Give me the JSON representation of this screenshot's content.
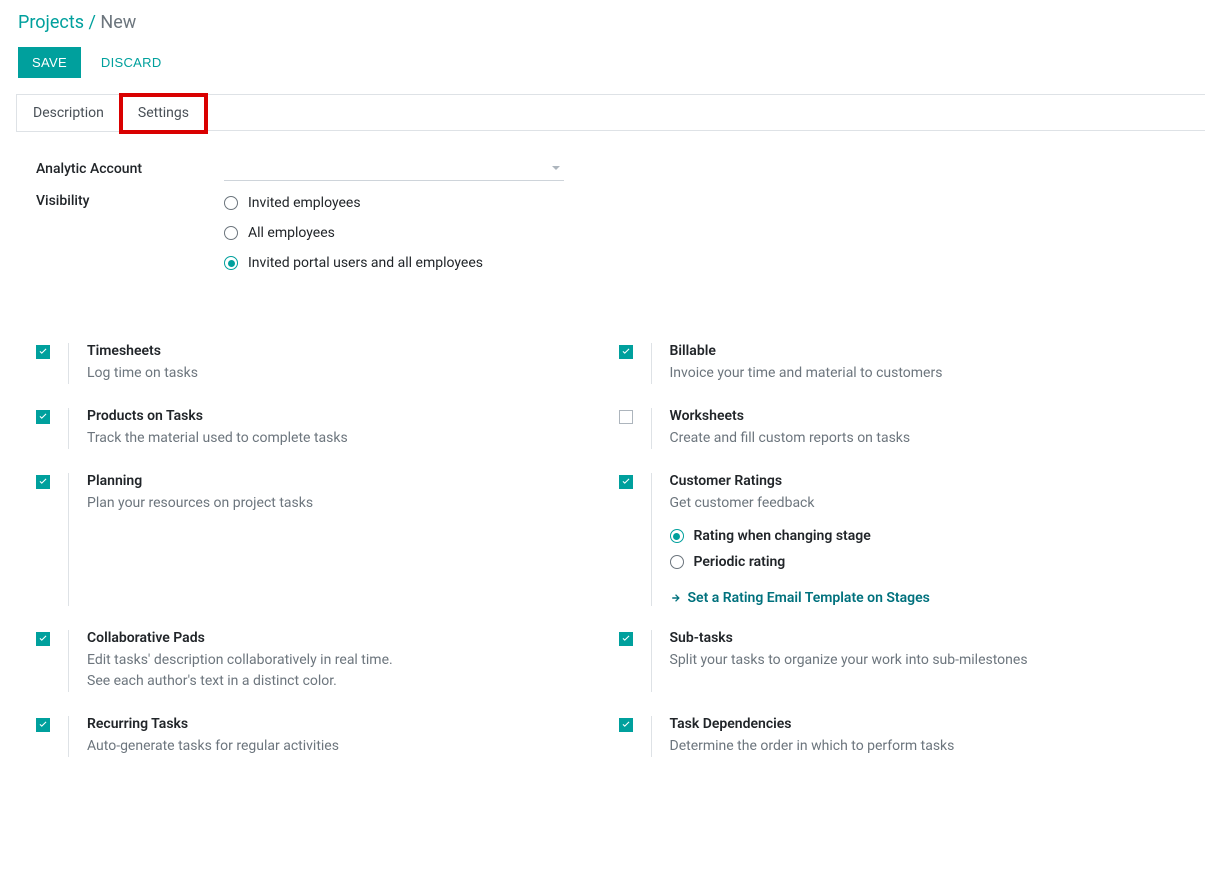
{
  "breadcrumb": {
    "root": "Projects",
    "separator": "/",
    "current": "New"
  },
  "actions": {
    "save": "SAVE",
    "discard": "DISCARD"
  },
  "tabs": {
    "description": "Description",
    "settings": "Settings"
  },
  "form": {
    "analytic_account_label": "Analytic Account",
    "visibility_label": "Visibility",
    "visibility_options": {
      "invited": "Invited employees",
      "all": "All employees",
      "portal": "Invited portal users and all employees"
    }
  },
  "features": {
    "timesheets": {
      "title": "Timesheets",
      "desc": "Log time on tasks",
      "checked": true
    },
    "billable": {
      "title": "Billable",
      "desc": "Invoice your time and material to customers",
      "checked": true
    },
    "products": {
      "title": "Products on Tasks",
      "desc": "Track the material used to complete tasks",
      "checked": true
    },
    "worksheets": {
      "title": "Worksheets",
      "desc": "Create and fill custom reports on tasks",
      "checked": false
    },
    "planning": {
      "title": "Planning",
      "desc": "Plan your resources on project tasks",
      "checked": true
    },
    "ratings": {
      "title": "Customer Ratings",
      "desc": "Get customer feedback",
      "checked": true,
      "options": {
        "on_stage": "Rating when changing stage",
        "periodic": "Periodic rating"
      },
      "link": "Set a Rating Email Template on Stages"
    },
    "pads": {
      "title": "Collaborative Pads",
      "desc1": "Edit tasks' description collaboratively in real time.",
      "desc2": "See each author's text in a distinct color.",
      "checked": true
    },
    "subtasks": {
      "title": "Sub-tasks",
      "desc": "Split your tasks to organize your work into sub-milestones",
      "checked": true
    },
    "recurring": {
      "title": "Recurring Tasks",
      "desc": "Auto-generate tasks for regular activities",
      "checked": true
    },
    "dependencies": {
      "title": "Task Dependencies",
      "desc": "Determine the order in which to perform tasks",
      "checked": true
    }
  }
}
